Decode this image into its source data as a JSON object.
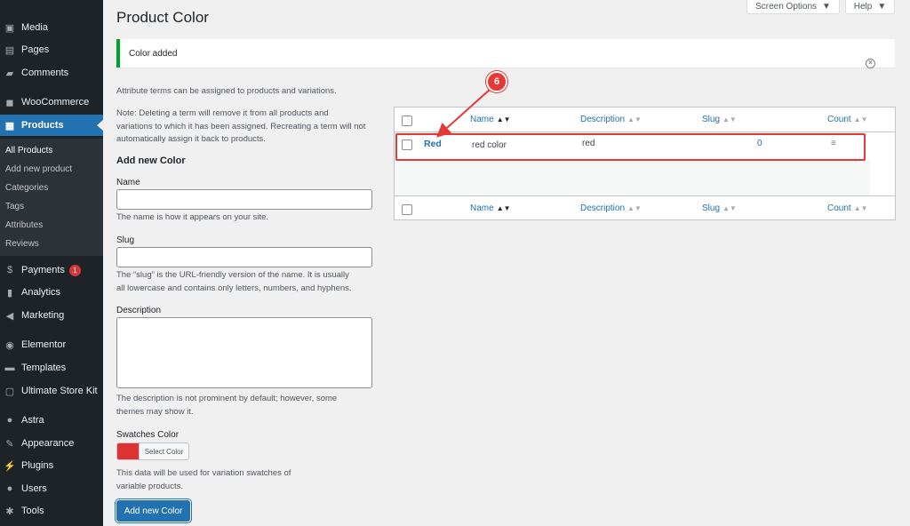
{
  "sidebar": {
    "items": [
      {
        "label": "Media",
        "icon": "media-icon"
      },
      {
        "label": "Pages",
        "icon": "pages-icon"
      },
      {
        "label": "Comments",
        "icon": "comments-icon"
      },
      {
        "label": "WooCommerce",
        "icon": "woocommerce-icon"
      },
      {
        "label": "Products",
        "icon": "products-icon"
      },
      {
        "label": "Payments",
        "icon": "payments-icon",
        "badge": "1"
      },
      {
        "label": "Analytics",
        "icon": "analytics-icon"
      },
      {
        "label": "Marketing",
        "icon": "marketing-icon"
      },
      {
        "label": "Elementor",
        "icon": "elementor-icon"
      },
      {
        "label": "Templates",
        "icon": "templates-icon"
      },
      {
        "label": "Ultimate Store Kit",
        "icon": "store-kit-icon"
      },
      {
        "label": "Astra",
        "icon": "astra-icon"
      },
      {
        "label": "Appearance",
        "icon": "appearance-icon"
      },
      {
        "label": "Plugins",
        "icon": "plugins-icon"
      },
      {
        "label": "Users",
        "icon": "users-icon"
      },
      {
        "label": "Tools",
        "icon": "tools-icon"
      }
    ],
    "submenu": [
      "All Products",
      "Add new product",
      "Categories",
      "Tags",
      "Attributes",
      "Reviews"
    ]
  },
  "header": {
    "screen_options": "Screen Options",
    "help": "Help",
    "title": "Product Color"
  },
  "notice": {
    "text": "Color added"
  },
  "form": {
    "intro": "Attribute terms can be assigned to products and variations.",
    "note_line1": "Note: Deleting a term will remove it from all products and",
    "note_line2": "variations to which it has been assigned. Recreating a term will not",
    "note_line3": "automatically assign it back to products.",
    "heading": "Add new Color",
    "name_label": "Name",
    "name_help": "The name is how it appears on your site.",
    "slug_label": "Slug",
    "slug_help_line1": "The “slug” is the URL-friendly version of the name. It is usually",
    "slug_help_line2": "all lowercase and contains only letters, numbers, and hyphens.",
    "description_label": "Description",
    "description_help_line1": "The description is not prominent by default; however, some",
    "description_help_line2": "themes may show it.",
    "swatches_label": "Swatches Color",
    "select_color": "Select Color",
    "swatch_color": "#dd3333",
    "swatches_help_line1": "This data will be used for variation swatches of",
    "swatches_help_line2": "variable products.",
    "submit": "Add new Color"
  },
  "table": {
    "columns": [
      "Name",
      "Description",
      "Slug",
      "Count"
    ],
    "rows": [
      {
        "name": "Red",
        "description": "red color",
        "slug": "red",
        "count": "0"
      }
    ]
  },
  "annotation": {
    "step": "6",
    "color": "#e53935"
  }
}
